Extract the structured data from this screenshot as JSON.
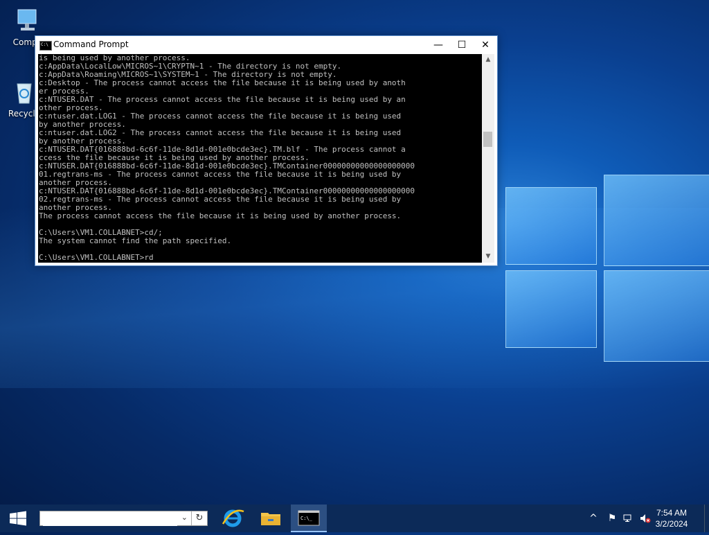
{
  "desktop": {
    "icons": [
      {
        "label": "Compu",
        "icon": "computer-icon"
      },
      {
        "label": "Recycle",
        "icon": "recycle-bin-icon"
      }
    ]
  },
  "window": {
    "title": "Command Prompt",
    "controls": {
      "minimize": "—",
      "maximize": "☐",
      "close": "✕"
    },
    "console_lines": [
      "is being used by another process.",
      "c:AppData\\LocalLow\\MICROS~1\\CRYPTN~1 - The directory is not empty.",
      "c:AppData\\Roaming\\MICROS~1\\SYSTEM~1 - The directory is not empty.",
      "c:Desktop - The process cannot access the file because it is being used by anoth",
      "er process.",
      "c:NTUSER.DAT - The process cannot access the file because it is being used by an",
      "other process.",
      "c:ntuser.dat.LOG1 - The process cannot access the file because it is being used",
      "by another process.",
      "c:ntuser.dat.LOG2 - The process cannot access the file because it is being used",
      "by another process.",
      "c:NTUSER.DAT{016888bd-6c6f-11de-8d1d-001e0bcde3ec}.TM.blf - The process cannot a",
      "ccess the file because it is being used by another process.",
      "c:NTUSER.DAT{016888bd-6c6f-11de-8d1d-001e0bcde3ec}.TMContainer00000000000000000000",
      "01.regtrans-ms - The process cannot access the file because it is being used by",
      "another process.",
      "c:NTUSER.DAT{016888bd-6c6f-11de-8d1d-001e0bcde3ec}.TMContainer00000000000000000000",
      "02.regtrans-ms - The process cannot access the file because it is being used by",
      "another process.",
      "The process cannot access the file because it is being used by another process.",
      "",
      "C:\\Users\\VM1.COLLABNET>cd/;",
      "The system cannot find the path specified.",
      "",
      "C:\\Users\\VM1.COLLABNET>rd"
    ]
  },
  "taskbar": {
    "search": {
      "value": "",
      "placeholder": ""
    },
    "apps": [
      {
        "name": "internet-explorer-icon"
      },
      {
        "name": "file-explorer-icon"
      },
      {
        "name": "command-prompt-icon",
        "active": true
      }
    ],
    "tray": {
      "chevron": "^",
      "time": "7:54 AM",
      "date": "3/2/2024"
    }
  },
  "colors": {
    "taskbar": "#0c2a58",
    "console_bg": "#000000",
    "console_text": "#c0c0c0",
    "window_border": "#5a8cc9"
  }
}
